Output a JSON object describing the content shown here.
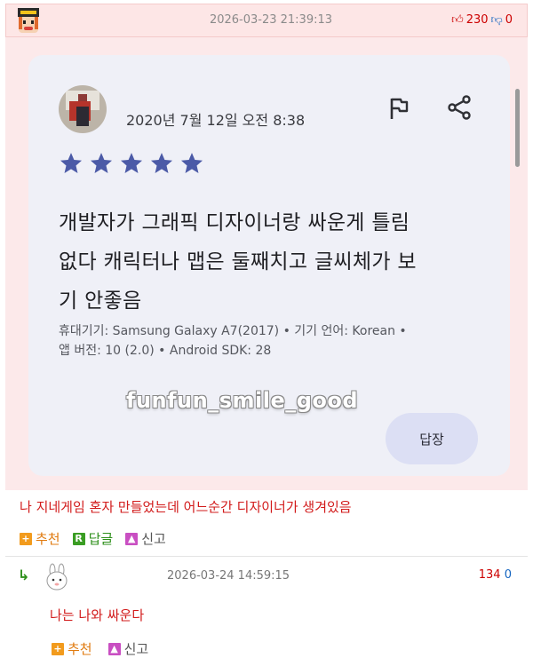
{
  "post": {
    "timestamp": "2026-03-23 21:39:13",
    "upvotes": "230",
    "downvotes": "0"
  },
  "review": {
    "date": "2020년 7월 12일 오전 8:38",
    "rating": 5,
    "text_line1": "개발자가 그래픽 디자이너랑 싸운게 틀림",
    "text_line2": "없다 캐릭터나 맵은 둘째치고 글씨체가 보",
    "text_line3": "기 안좋음",
    "meta_line1": "휴대기기: Samsung Galaxy A7(2017) • 기기 언어: Korean •",
    "meta_line2": "앱 버전: 10 (2.0) • Android SDK: 28",
    "reply_button": "답장",
    "star_color": "#4b5aa7"
  },
  "watermark": "funfun_smile_good",
  "comment": {
    "text": "나 지네게임 혼자 만들었는데 어느순간 디자이너가 생겨있음",
    "recommend_label": "추천",
    "reply_label": "답글",
    "report_label": "신고"
  },
  "reply": {
    "timestamp": "2026-03-24 14:59:15",
    "upvotes": "134",
    "downvotes": "0",
    "text": "나는 나와 싸운다",
    "recommend_label": "추천",
    "report_label": "신고"
  }
}
